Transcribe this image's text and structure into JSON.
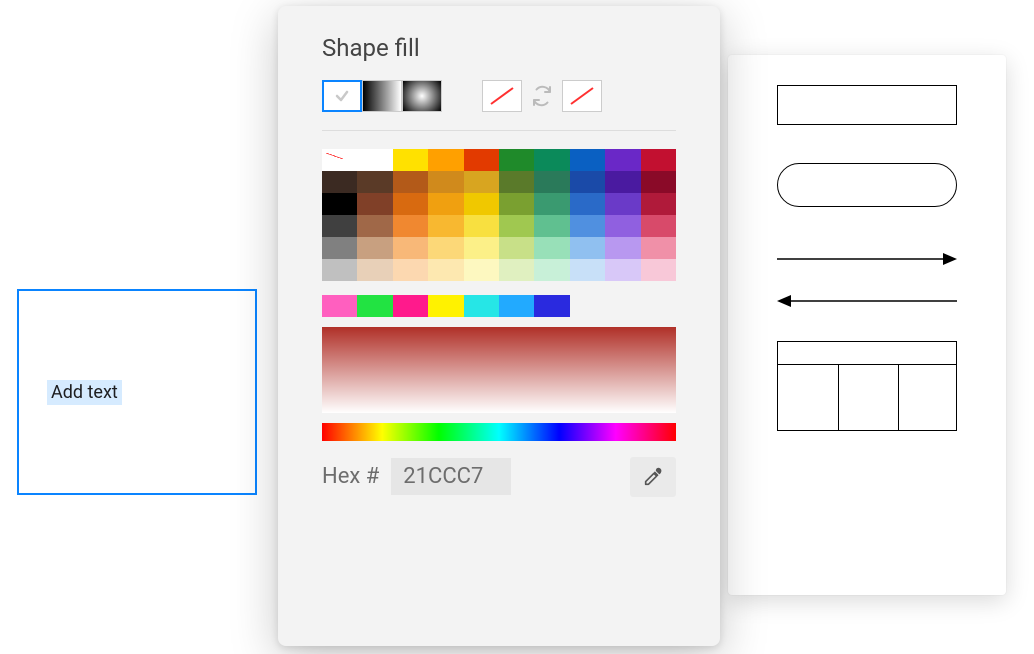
{
  "picker": {
    "title": "Shape fill",
    "hex_label": "Hex #",
    "hex_value": "21CCC7",
    "fill_modes": {
      "solid_selected": true
    },
    "palette": [
      [
        null,
        "#ffffff",
        "#ffe100",
        "#ffa000",
        "#e23a00",
        "#1f8a2a",
        "#0b8a5a",
        "#0a60c2",
        "#6a28c7",
        "#c21030"
      ],
      [
        "#3b2a22",
        "#5a3a27",
        "#b35a19",
        "#d08a1c",
        "#d8a520",
        "#5a7a2a",
        "#2a7a5a",
        "#1a4aa8",
        "#4a1aa0",
        "#8a0a28"
      ],
      [
        "#000000",
        "#804028",
        "#d86a10",
        "#f0a010",
        "#f0c800",
        "#7aa030",
        "#3a9a70",
        "#2a6ac8",
        "#6a3ac8",
        "#b01a3a"
      ],
      [
        "#404040",
        "#a06848",
        "#f08830",
        "#f8b830",
        "#f8e040",
        "#a0c850",
        "#60c090",
        "#5090e0",
        "#9060e0",
        "#d84a6a"
      ],
      [
        "#808080",
        "#c8a080",
        "#f8b878",
        "#fcd878",
        "#fcf088",
        "#c8e088",
        "#98e0b8",
        "#90c0f0",
        "#b898f0",
        "#f090a8"
      ],
      [
        "#c0c0c0",
        "#e8d0b8",
        "#fcd8b0",
        "#fde8b0",
        "#fdf8c0",
        "#e0f0c0",
        "#c8f0d8",
        "#c8e0f8",
        "#d8c8f8",
        "#f8c8d8"
      ]
    ],
    "recent": [
      "#ff5fbf",
      "#22e342",
      "#ff1a8c",
      "#fff200",
      "#26e6e6",
      "#22aaff",
      "#2a2adf"
    ]
  },
  "textbox": {
    "placeholder": "Add text"
  },
  "shapes_panel": {
    "items": [
      "rectangle",
      "rounded-rectangle",
      "arrow-right",
      "arrow-left",
      "table"
    ]
  }
}
